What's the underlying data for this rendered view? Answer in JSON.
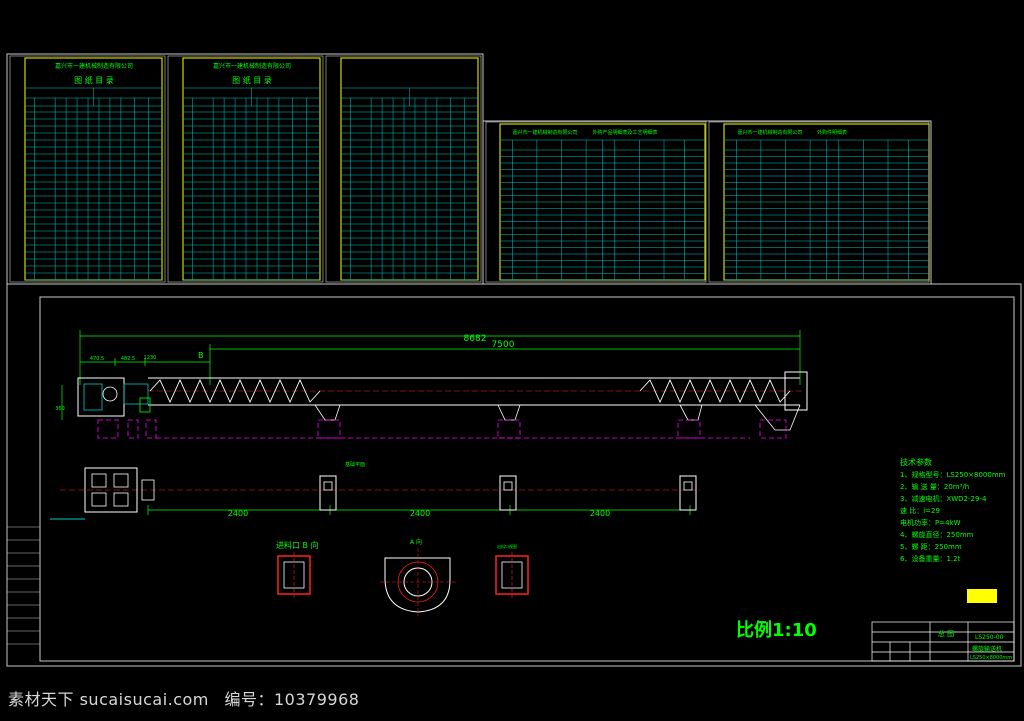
{
  "sheets": [
    {
      "company": "嘉兴市一建机械制造有限公司",
      "title": "图 纸 目 录",
      "row_numbers": [
        "1",
        "2",
        "3",
        "4",
        "5",
        "6",
        "7",
        "8",
        "9",
        "10",
        "11",
        "12",
        "13",
        "14",
        "15",
        "16",
        "17",
        "18",
        "19",
        "20",
        "21",
        "22",
        "23",
        "24"
      ]
    },
    {
      "company": "嘉兴市一建机械制造有限公司",
      "title": "图 纸 目 录"
    },
    {
      "company": "",
      "title": ""
    },
    {
      "company": "嘉兴市一建机械制造有限公司",
      "title": "外购产品明细表及工艺明细表"
    },
    {
      "company": "嘉兴市一建机械制造有限公司",
      "title": "外购件明细表"
    }
  ],
  "drawing": {
    "dimensions": {
      "overall": "8682",
      "span": "7500",
      "left_a": "470.5",
      "left_b": "482.5",
      "left_c": "1230",
      "height": "360",
      "pitch_1": "2400",
      "pitch_2": "2400",
      "pitch_3": "2400"
    },
    "section_label": "B",
    "plan_label": "基础平面",
    "inlet_view_label": "进料口 B 向",
    "section_a_label": "A 向",
    "outlet_label": "出料口视图",
    "scale": "比例1:10"
  },
  "tech_params": {
    "title": "技术参数",
    "lines": [
      "1、规格型号：LS250×8000mm",
      "2、输 送 量：20m³/h",
      "3、减速电机：XWD2-29-4",
      "   速 比：i=29",
      "   电机功率：P=4kW",
      "4、螺旋直径：250mm",
      "5、螺 距：250mm",
      "6、设备重量：1.2t"
    ]
  },
  "title_block": {
    "name": "总 图",
    "code": "LS250-00",
    "product": "螺旋输送机",
    "spec": "LS250×8000mm"
  },
  "watermark": {
    "site": "素材天下 sucaisucai.com",
    "id_label": "编号：10379968"
  },
  "colors": {
    "frame": "#c8c8c8",
    "sheet": "#ffff00",
    "grid": "#00c8c8",
    "dim": "#00ff00",
    "struct": "#ffffff",
    "red": "#ff2020",
    "magenta": "#ff00ff",
    "text": "#00ff00"
  }
}
